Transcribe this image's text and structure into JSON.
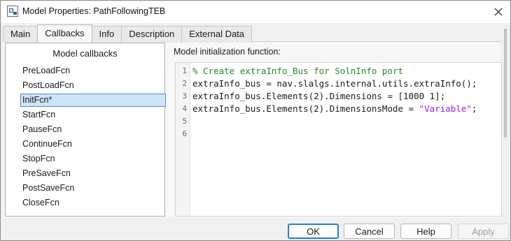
{
  "window": {
    "title": "Model Properties: PathFollowingTEB"
  },
  "tabs": [
    {
      "label": "Main"
    },
    {
      "label": "Callbacks"
    },
    {
      "label": "Info"
    },
    {
      "label": "Description"
    },
    {
      "label": "External Data"
    }
  ],
  "active_tab": "Callbacks",
  "callbacks": {
    "header": "Model callbacks",
    "items": [
      {
        "label": "PreLoadFcn"
      },
      {
        "label": "PostLoadFcn"
      },
      {
        "label": "InitFcn*"
      },
      {
        "label": "StartFcn"
      },
      {
        "label": "PauseFcn"
      },
      {
        "label": "ContinueFcn"
      },
      {
        "label": "StopFcn"
      },
      {
        "label": "PreSaveFcn"
      },
      {
        "label": "PostSaveFcn"
      },
      {
        "label": "CloseFcn"
      }
    ],
    "selected": "InitFcn*"
  },
  "editor": {
    "label": "Model initialization function:",
    "line_numbers": [
      "1",
      "2",
      "3",
      "4",
      "5",
      "6"
    ],
    "lines": [
      {
        "segments": [
          {
            "text": "% Create extraInfo_Bus for SolnInfo port",
            "kind": "comment"
          }
        ]
      },
      {
        "segments": [
          {
            "text": "extraInfo_bus = nav.slalgs.internal.utils.extraInfo();",
            "kind": "code"
          }
        ]
      },
      {
        "segments": [
          {
            "text": "extraInfo_bus.Elements(2).Dimensions = [1000 1];",
            "kind": "code"
          }
        ]
      },
      {
        "segments": [
          {
            "text": "extraInfo_bus.Elements(2).DimensionsMode = ",
            "kind": "code"
          },
          {
            "text": "\"Variable\"",
            "kind": "string"
          },
          {
            "text": ";",
            "kind": "code"
          }
        ]
      },
      {
        "segments": []
      },
      {
        "segments": []
      }
    ]
  },
  "buttons": {
    "ok": "OK",
    "cancel": "Cancel",
    "help": "Help",
    "apply": "Apply"
  },
  "colors": {
    "accent": "#2b7bd6",
    "selection": "#cfe3f7",
    "comment": "#228b22",
    "string": "#a020f0"
  }
}
